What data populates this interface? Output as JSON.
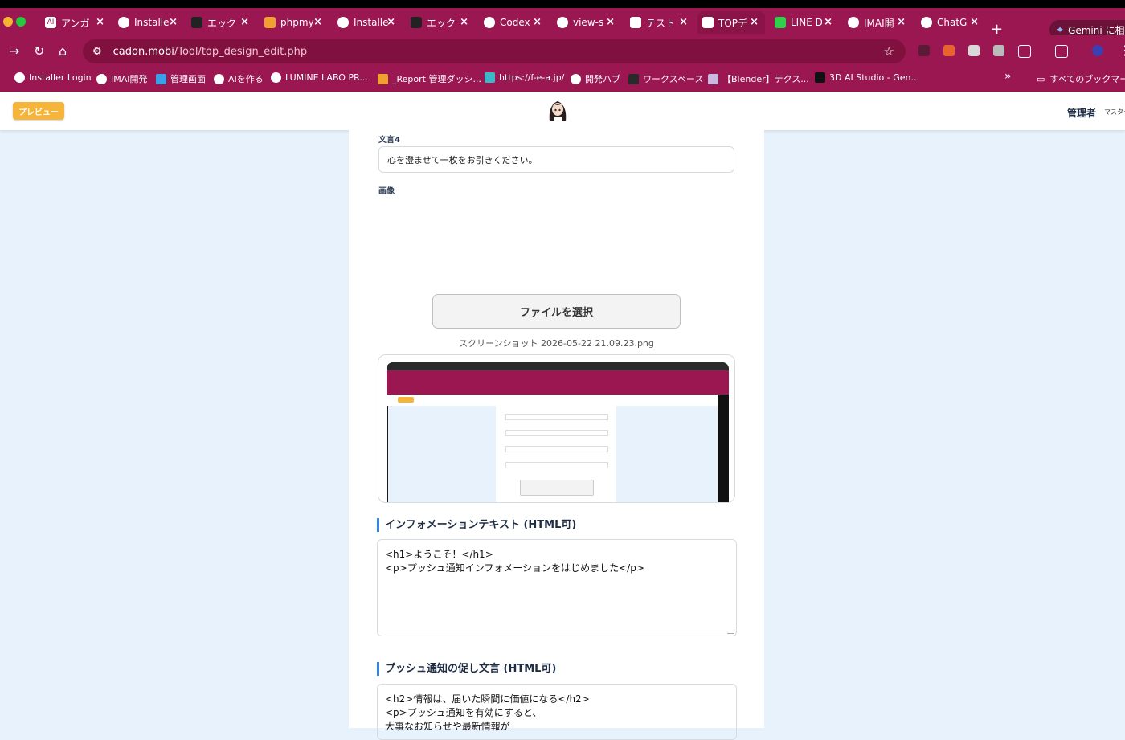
{
  "browser": {
    "tabs": [
      {
        "title": "アンガ"
      },
      {
        "title": "Installe"
      },
      {
        "title": "エック"
      },
      {
        "title": "phpmy"
      },
      {
        "title": "Installe"
      },
      {
        "title": "エック"
      },
      {
        "title": "Codex"
      },
      {
        "title": "view-s"
      },
      {
        "title": "テスト"
      },
      {
        "title": "TOPデ"
      },
      {
        "title": "LINE D"
      },
      {
        "title": "IMAI開"
      },
      {
        "title": "ChatG"
      }
    ],
    "new_tab": "+",
    "gemini_label": "Gemini に相談",
    "url_host": "cadon.mobi",
    "url_path": "/Tool/top_design_edit.php",
    "bookmarks": [
      "Installer Login",
      "IMAI開発",
      "管理画面",
      "AIを作る",
      "LUMINE LABO PR...",
      "_Report 管理ダッシ...",
      "https://f-e-a.jp/",
      "開発ハブ",
      "ワークスペース",
      "【Blender】テクス...",
      "3D AI Studio - Gen..."
    ],
    "bookmarks_more": "»",
    "all_bookmarks": "すべてのブックマーク"
  },
  "header": {
    "preview_button": "プレビュー",
    "admin_label": "管理者",
    "master_label": "マスター"
  },
  "form": {
    "field4_label": "文言4",
    "field4_value": "心を澄ませて一枚をお引きください。",
    "image_label": "画像",
    "file_button": "ファイルを選択",
    "file_name": "スクリーンショット 2026-05-22 21.09.23.png",
    "info_title": "インフォメーションテキスト (HTML可)",
    "info_lines": [
      "<h1>ようこそ！</h1>",
      "<p>プッシュ通知インフォメーションをはじめました</p>"
    ],
    "push_title": "プッシュ通知の促し文言 (HTML可)",
    "push_lines": [
      "<h2>情報は、届いた瞬間に価値になる</h2>",
      "<p>プッシュ通知を有効にすると、",
      "大事なお知らせや最新情報が"
    ]
  }
}
